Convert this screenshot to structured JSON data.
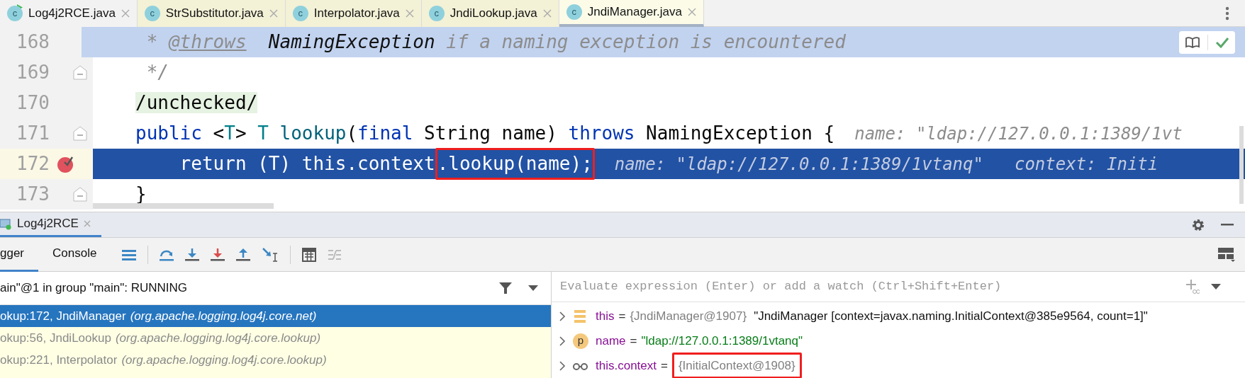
{
  "editor_tabs": [
    {
      "label": "Log4j2RCE.java",
      "badge": "c",
      "kind": "project",
      "running": true,
      "selected": false
    },
    {
      "label": "StrSubstitutor.java",
      "badge": "c",
      "kind": "library",
      "running": false,
      "selected": false
    },
    {
      "label": "Interpolator.java",
      "badge": "c",
      "kind": "library",
      "running": false,
      "selected": false
    },
    {
      "label": "JndiLookup.java",
      "badge": "c",
      "kind": "library",
      "running": false,
      "selected": false
    },
    {
      "label": "JndiManager.java",
      "badge": "c",
      "kind": "library",
      "running": false,
      "selected": true
    }
  ],
  "editor": {
    "lines": [
      {
        "number": "168",
        "doc_selected": true,
        "execution_point": false,
        "breakpoint": false,
        "fold": false,
        "tokens": [
          {
            "text": " * ",
            "kind": "comment"
          },
          {
            "text": "@throws",
            "kind": "doctag"
          },
          {
            "text": "  NamingException",
            "kind": "doctype"
          },
          {
            "text": " if a naming exception is encountered",
            "kind": "comment"
          }
        ]
      },
      {
        "number": "169",
        "doc_selected": false,
        "execution_point": false,
        "breakpoint": false,
        "fold": true,
        "tokens": [
          {
            "text": " */",
            "kind": "comment"
          }
        ]
      },
      {
        "number": "170",
        "doc_selected": false,
        "execution_point": false,
        "breakpoint": false,
        "fold": false,
        "tokens": [
          {
            "text": "/unchecked/",
            "kind": "marked"
          }
        ]
      },
      {
        "number": "171",
        "doc_selected": false,
        "execution_point": false,
        "breakpoint": false,
        "fold": true,
        "tokens": [
          {
            "text": "public",
            "kind": "keyword"
          },
          {
            "text": " <",
            "kind": "plain"
          },
          {
            "text": "T",
            "kind": "type"
          },
          {
            "text": "> ",
            "kind": "plain"
          },
          {
            "text": "T",
            "kind": "type"
          },
          {
            "text": " lookup",
            "kind": "method"
          },
          {
            "text": "(",
            "kind": "plain"
          },
          {
            "text": "final",
            "kind": "keyword"
          },
          {
            "text": " String name) ",
            "kind": "plain"
          },
          {
            "text": "throws",
            "kind": "keyword"
          },
          {
            "text": " NamingException {",
            "kind": "plain"
          }
        ],
        "hints": [
          "name: \"ldap://127.0.0.1:1389/1vt"
        ]
      },
      {
        "number": "172",
        "doc_selected": false,
        "execution_point": true,
        "breakpoint": true,
        "fold": false,
        "tokens": [
          {
            "text": "    return (T) this.context",
            "kind": "plain"
          },
          {
            "text": ".lookup(name);",
            "kind": "plain",
            "boxed": true
          }
        ],
        "hints": [
          "name: \"ldap://127.0.0.1:1389/1vtanq\"",
          "context: Initi"
        ]
      },
      {
        "number": "173",
        "doc_selected": false,
        "execution_point": false,
        "breakpoint": false,
        "fold": true,
        "tokens": [
          {
            "text": "}",
            "kind": "plain"
          }
        ]
      }
    ]
  },
  "debug": {
    "title": "Log4j2RCE",
    "tabs": [
      {
        "label": "gger",
        "selected": true
      },
      {
        "label": "Console",
        "selected": false
      }
    ],
    "thread": "ain\"@1 in group \"main\": RUNNING",
    "evaluate": {
      "placeholder": "Evaluate expression (Enter) or add a watch (Ctrl+Shift+Enter)"
    },
    "frames": [
      {
        "method": "okup:172, JndiManager",
        "package": "(org.apache.logging.log4j.core.net)",
        "selected": true
      },
      {
        "method": "okup:56, JndiLookup",
        "package": "(org.apache.logging.log4j.core.lookup)",
        "selected": false
      },
      {
        "method": "okup:221, Interpolator",
        "package": "(org.apache.logging.log4j.core.lookup)",
        "selected": false
      }
    ],
    "variables": [
      {
        "kind": "field",
        "name": "this",
        "operator": "=",
        "value": "{JndiManager@1907}",
        "string_value": false,
        "description": "\"JndiManager [context=javax.naming.InitialContext@385e9564, count=1]\"",
        "boxed": false
      },
      {
        "kind": "parameter",
        "badge": "p",
        "name": "name",
        "operator": "=",
        "value": "\"ldap://127.0.0.1:1389/1vtanq\"",
        "string_value": true,
        "boxed": false
      },
      {
        "kind": "watch",
        "name": "this.context",
        "operator": "=",
        "value": "{InitialContext@1908}",
        "string_value": false,
        "boxed": true
      }
    ]
  }
}
